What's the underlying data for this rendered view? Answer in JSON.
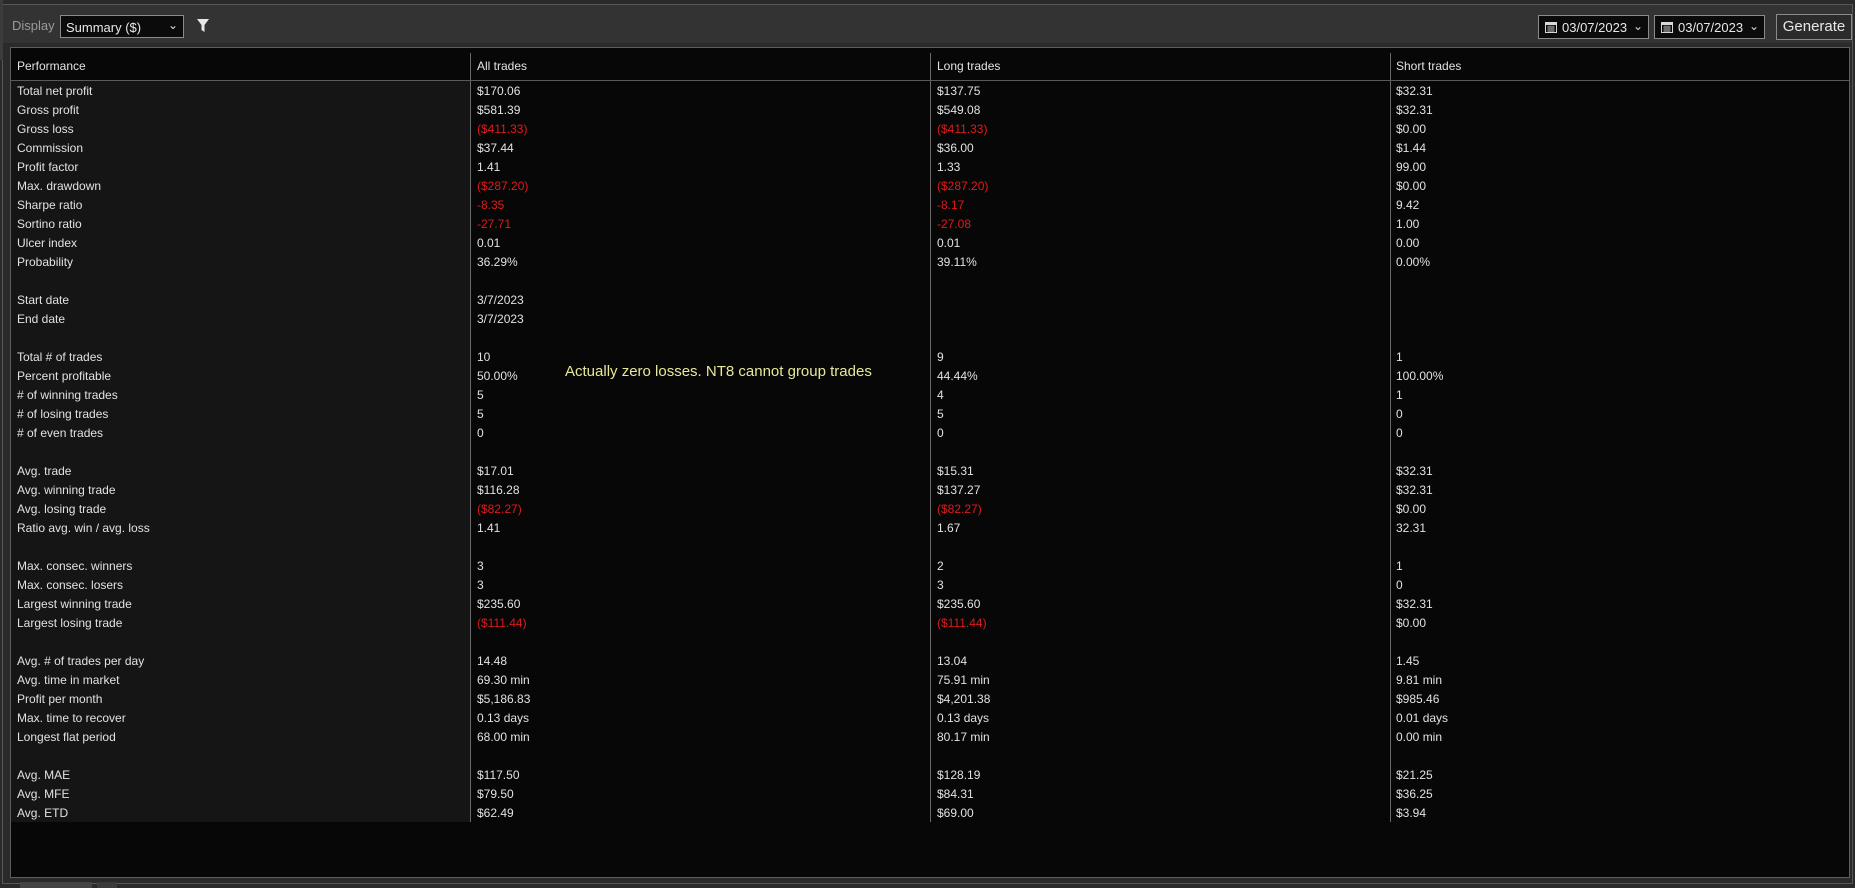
{
  "toolbar": {
    "display_label": "Display",
    "display_value": "Summary ($)",
    "date_from": "03/07/2023",
    "date_to": "03/07/2023",
    "generate_label": "Generate"
  },
  "headers": [
    "Performance",
    "All trades",
    "Long trades",
    "Short trades"
  ],
  "annotation": "Actually zero losses. NT8 cannot group trades",
  "colors": {
    "negative": "#e01a1a",
    "annotation": "#e8e89a"
  },
  "rows": [
    {
      "label": "Total net profit",
      "all": "$170.06",
      "long": "$137.75",
      "short": "$32.31"
    },
    {
      "label": "Gross profit",
      "all": "$581.39",
      "long": "$549.08",
      "short": "$32.31"
    },
    {
      "label": "Gross loss",
      "all": "($411.33)",
      "long": "($411.33)",
      "short": "$0.00"
    },
    {
      "label": "Commission",
      "all": "$37.44",
      "long": "$36.00",
      "short": "$1.44"
    },
    {
      "label": "Profit factor",
      "all": "1.41",
      "long": "1.33",
      "short": "99.00"
    },
    {
      "label": "Max. drawdown",
      "all": "($287.20)",
      "long": "($287.20)",
      "short": "$0.00"
    },
    {
      "label": "Sharpe ratio",
      "all": "-8.35",
      "long": "-8.17",
      "short": "9.42"
    },
    {
      "label": "Sortino ratio",
      "all": "-27.71",
      "long": "-27.08",
      "short": "1.00"
    },
    {
      "label": "Ulcer index",
      "all": "0.01",
      "long": "0.01",
      "short": "0.00"
    },
    {
      "label": "Probability",
      "all": "36.29%",
      "long": "39.11%",
      "short": "0.00%"
    },
    {
      "label": "",
      "all": "",
      "long": "",
      "short": ""
    },
    {
      "label": "Start date",
      "all": "3/7/2023",
      "long": "",
      "short": ""
    },
    {
      "label": "End date",
      "all": "3/7/2023",
      "long": "",
      "short": ""
    },
    {
      "label": "",
      "all": "",
      "long": "",
      "short": ""
    },
    {
      "label": "Total # of trades",
      "all": "10",
      "long": "9",
      "short": "1"
    },
    {
      "label": "Percent profitable",
      "all": "50.00%",
      "long": "44.44%",
      "short": "100.00%"
    },
    {
      "label": "# of winning trades",
      "all": "5",
      "long": "4",
      "short": "1"
    },
    {
      "label": "# of losing trades",
      "all": "5",
      "long": "5",
      "short": "0"
    },
    {
      "label": "# of even trades",
      "all": "0",
      "long": "0",
      "short": "0"
    },
    {
      "label": "",
      "all": "",
      "long": "",
      "short": ""
    },
    {
      "label": "Avg. trade",
      "all": "$17.01",
      "long": "$15.31",
      "short": "$32.31"
    },
    {
      "label": "Avg. winning trade",
      "all": "$116.28",
      "long": "$137.27",
      "short": "$32.31"
    },
    {
      "label": "Avg. losing trade",
      "all": "($82.27)",
      "long": "($82.27)",
      "short": "$0.00"
    },
    {
      "label": "Ratio avg. win / avg. loss",
      "all": "1.41",
      "long": "1.67",
      "short": "32.31"
    },
    {
      "label": "",
      "all": "",
      "long": "",
      "short": ""
    },
    {
      "label": "Max. consec. winners",
      "all": "3",
      "long": "2",
      "short": "1"
    },
    {
      "label": "Max. consec. losers",
      "all": "3",
      "long": "3",
      "short": "0"
    },
    {
      "label": "Largest winning trade",
      "all": "$235.60",
      "long": "$235.60",
      "short": "$32.31"
    },
    {
      "label": "Largest losing trade",
      "all": "($111.44)",
      "long": "($111.44)",
      "short": "$0.00"
    },
    {
      "label": "",
      "all": "",
      "long": "",
      "short": ""
    },
    {
      "label": "Avg. # of trades per day",
      "all": "14.48",
      "long": "13.04",
      "short": "1.45"
    },
    {
      "label": "Avg. time in market",
      "all": "69.30 min",
      "long": "75.91 min",
      "short": "9.81 min"
    },
    {
      "label": "Profit per month",
      "all": "$5,186.83",
      "long": "$4,201.38",
      "short": "$985.46"
    },
    {
      "label": "Max. time to recover",
      "all": "0.13 days",
      "long": "0.13 days",
      "short": "0.01 days"
    },
    {
      "label": "Longest flat period",
      "all": "68.00 min",
      "long": "80.17 min",
      "short": "0.00 min"
    },
    {
      "label": "",
      "all": "",
      "long": "",
      "short": ""
    },
    {
      "label": "Avg. MAE",
      "all": "$117.50",
      "long": "$128.19",
      "short": "$21.25"
    },
    {
      "label": "Avg. MFE",
      "all": "$79.50",
      "long": "$84.31",
      "short": "$36.25"
    },
    {
      "label": "Avg. ETD",
      "all": "$62.49",
      "long": "$69.00",
      "short": "$3.94"
    }
  ]
}
